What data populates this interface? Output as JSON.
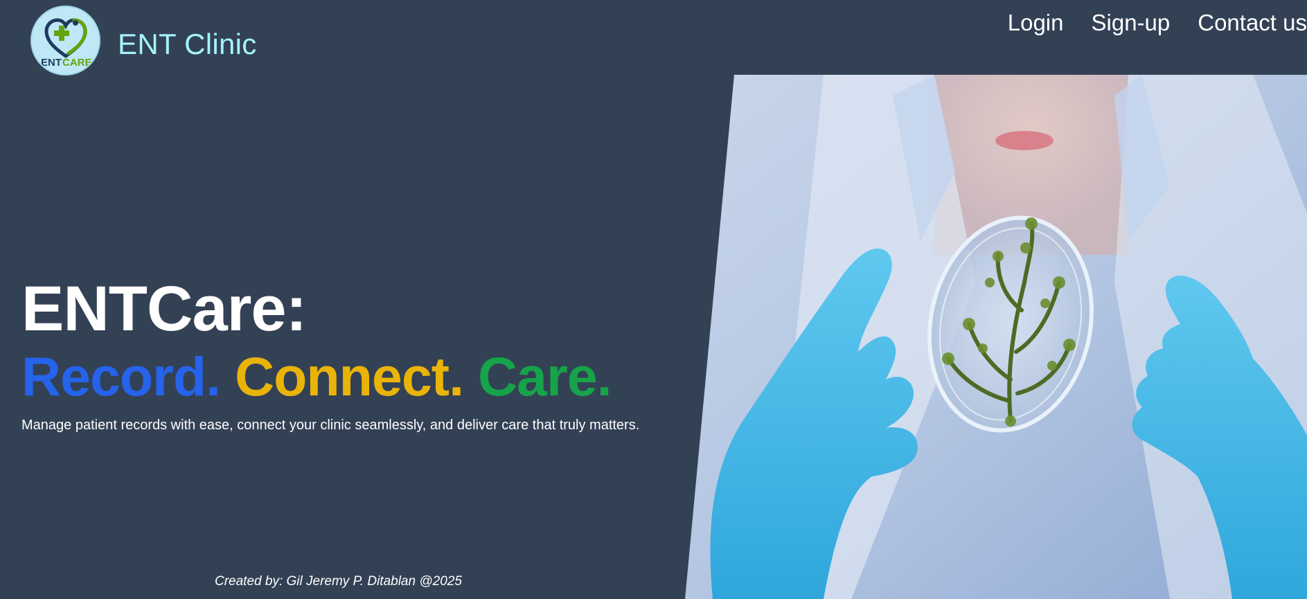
{
  "header": {
    "logo_text_ent": "ENT",
    "logo_text_care": "CARE",
    "brand_name": "ENT Clinic"
  },
  "nav": {
    "items": [
      {
        "label": "Login"
      },
      {
        "label": "Sign-up"
      },
      {
        "label": "Contact us"
      }
    ]
  },
  "hero": {
    "title": "ENTCare:",
    "tagline": {
      "record": "Record.",
      "connect": "Connect.",
      "care": "Care."
    },
    "subtitle": "Manage patient records with ease, connect your clinic seamlessly, and deliver care that truly matters."
  },
  "footer": {
    "credit": "Created by: Gil Jeremy P. Ditablan @2025"
  },
  "colors": {
    "background": "#334155",
    "brand": "#a5f3fc",
    "record": "#2563eb",
    "connect": "#eab308",
    "care": "#16a34a"
  },
  "images": {
    "hero_image_icon": "scientist-petri-dish-photo"
  }
}
